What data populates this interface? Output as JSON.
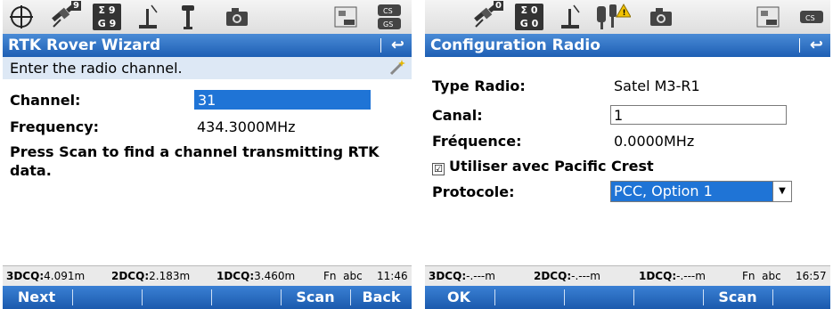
{
  "left": {
    "status_icons": [
      "gps-target-icon",
      "satellite-icon",
      "sat-count-icon",
      "rover-pole-icon",
      "antenna-pole-icon",
      "camera-icon",
      "cf-card-icon",
      "cs-storage-icon"
    ],
    "sat_counts": {
      "top_sym": "Σ",
      "top_num": "9",
      "bot_sym": "G",
      "bot_num": "9"
    },
    "sat_badge": "9",
    "title": "RTK Rover Wizard",
    "back_symbol": "↩",
    "hint": "Enter the radio channel.",
    "channel_label": "Channel:",
    "channel_value": "31",
    "frequency_label": "Frequency:",
    "frequency_value": "434.3000MHz",
    "instructions": "Press Scan to find a channel transmitting RTK data.",
    "info": {
      "dcq3_label": "3DCQ:",
      "dcq3_value": "4.091m",
      "dcq2_label": "2DCQ:",
      "dcq2_value": "2.183m",
      "dcq1_label": "1DCQ:",
      "dcq1_value": "3.460m",
      "mode": "Fn  abc",
      "time": "11:46"
    },
    "softkeys": {
      "next": "Next",
      "scan": "Scan",
      "back": "Back"
    }
  },
  "right": {
    "status_icons": [
      "satellite-icon",
      "sat-count-icon",
      "rover-pole-icon",
      "radio-warning-icon",
      "camera-icon",
      "cf-card-icon",
      "cs-storage-icon"
    ],
    "sat_counts": {
      "top_sym": "Σ",
      "top_num": "0",
      "bot_sym": "G",
      "bot_num": "0"
    },
    "sat_badge": "0",
    "title": "Configuration Radio",
    "back_symbol": "↩",
    "type_label": "Type Radio:",
    "type_value": "Satel M3-R1",
    "canal_label": "Canal:",
    "canal_value": "1",
    "freq_label": "Fréquence:",
    "freq_value": "0.0000MHz",
    "checkbox_mark": "☑",
    "checkbox_label": "Utiliser avec Pacific Crest",
    "protocol_label": "Protocole:",
    "protocol_value": "PCC, Option 1",
    "protocol_arrow": "▼",
    "info": {
      "dcq3_label": "3DCQ:",
      "dcq3_value": "-.---m",
      "dcq2_label": "2DCQ:",
      "dcq2_value": "-.---m",
      "dcq1_label": "1DCQ:",
      "dcq1_value": "-.---m",
      "mode": "Fn  abc",
      "time": "16:57"
    },
    "softkeys": {
      "ok": "OK",
      "scan": "Scan"
    }
  },
  "colors": {
    "title_blue": "#1e5fb4",
    "selection_blue": "#1f74d6",
    "hint_bg": "#dde8f5"
  }
}
